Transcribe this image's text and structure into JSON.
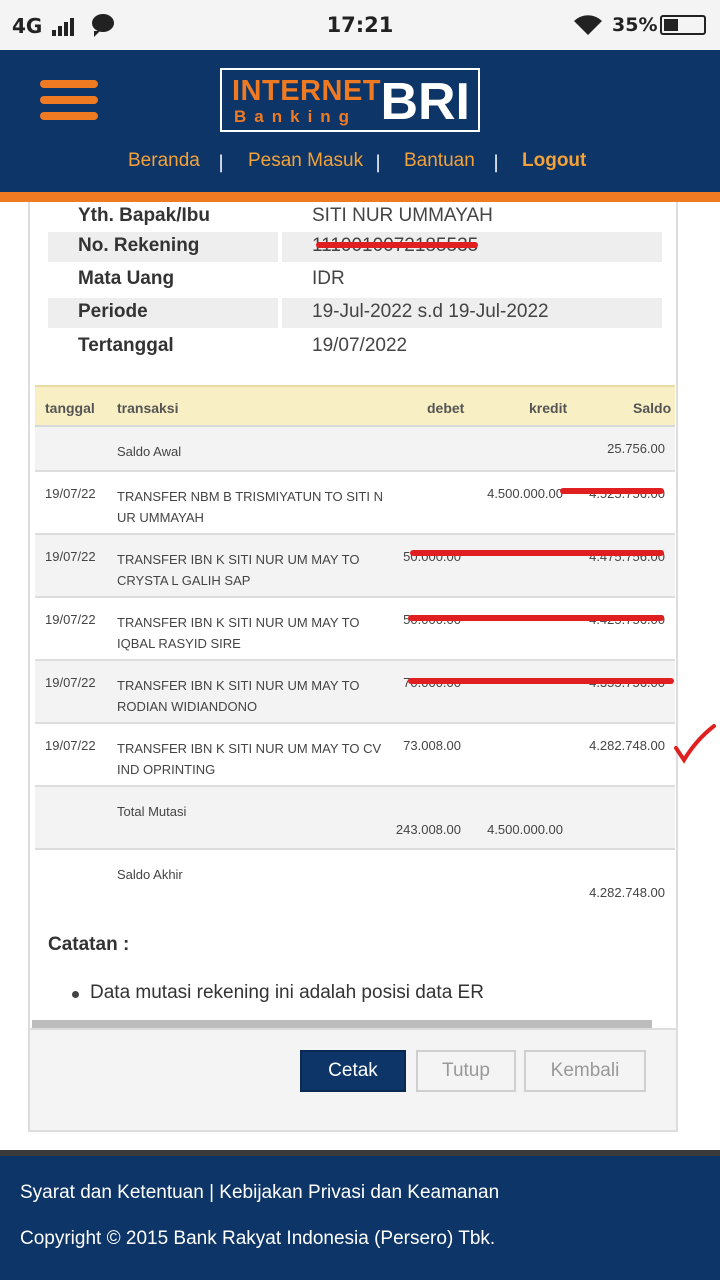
{
  "status_bar": {
    "network": "4G",
    "time": "17:21",
    "battery_pct": "35%"
  },
  "header": {
    "logo": {
      "line1": "INTERNET",
      "line2": "Banking",
      "brand": "BRI"
    },
    "nav": [
      {
        "label": "Beranda"
      },
      {
        "label": "Pesan Masuk"
      },
      {
        "label": "Bantuan"
      },
      {
        "label": "Logout"
      }
    ],
    "nav_separator": "|"
  },
  "account_info": [
    {
      "label": "Yth. Bapak/Ibu",
      "value": "SITI NUR UMMAYAH"
    },
    {
      "label": "No. Rekening",
      "value": "1110010072185535"
    },
    {
      "label": "Mata Uang",
      "value": "IDR"
    },
    {
      "label": "Periode",
      "value": "19-Jul-2022 s.d 19-Jul-2022"
    },
    {
      "label": "Tertanggal",
      "value": "19/07/2022"
    }
  ],
  "table": {
    "headers": {
      "tanggal": "tanggal",
      "transaksi": "transaksi",
      "debet": "debet",
      "kredit": "kredit",
      "saldo": "Saldo"
    },
    "rows": [
      {
        "tanggal": "",
        "transaksi": "Saldo Awal",
        "debet": "",
        "kredit": "",
        "saldo": "25.756.00"
      },
      {
        "tanggal": "19/07/22",
        "transaksi": "TRANSFER NBM B TRISMIYATUN TO SITI N UR UMMAYAH",
        "debet": "",
        "kredit": "4.500.000.00",
        "saldo": "4.525.756.00"
      },
      {
        "tanggal": "19/07/22",
        "transaksi": "TRANSFER IBN K SITI NUR UM MAY TO CRYSTA L GALIH SAP",
        "debet": "50.000.00",
        "kredit": "",
        "saldo": "4.475.756.00"
      },
      {
        "tanggal": "19/07/22",
        "transaksi": "TRANSFER IBN K SITI NUR UM MAY TO IQBAL RASYID SIRE",
        "debet": "50.000.00",
        "kredit": "",
        "saldo": "4.425.756.00"
      },
      {
        "tanggal": "19/07/22",
        "transaksi": "TRANSFER IBN K SITI NUR UM MAY TO RODIAN WIDIANDONO",
        "debet": "70.000.00",
        "kredit": "",
        "saldo": "4.355.756.00"
      },
      {
        "tanggal": "19/07/22",
        "transaksi": "TRANSFER IBN K SITI NUR UM MAY TO CV IND OPRINTING",
        "debet": "73.008.00",
        "kredit": "",
        "saldo": "4.282.748.00"
      }
    ],
    "total": {
      "label": "Total Mutasi",
      "debet": "243.008.00",
      "kredit": "4.500.000.00"
    },
    "saldo_akhir": {
      "label": "Saldo Akhir",
      "saldo": "4.282.748.00"
    }
  },
  "catatan": {
    "title": "Catatan :",
    "items": [
      "Data mutasi rekening ini adalah posisi data ER"
    ]
  },
  "buttons": {
    "cetak": "Cetak",
    "tutup": "Tutup",
    "kembali": "Kembali"
  },
  "footer": {
    "links": "Syarat dan Ketentuan | Kebijakan Privasi dan Keamanan",
    "copyright": "Copyright © 2015 Bank Rakyat Indonesia (Persero) Tbk."
  },
  "colors": {
    "navy": "#0d3567",
    "orange": "#ef7a22",
    "annotation_red": "#e02020"
  },
  "icons": [
    "signal-icon",
    "chat-icon",
    "wifi-icon",
    "battery-icon",
    "hamburger-menu-icon",
    "checkmark-annotation-icon"
  ]
}
